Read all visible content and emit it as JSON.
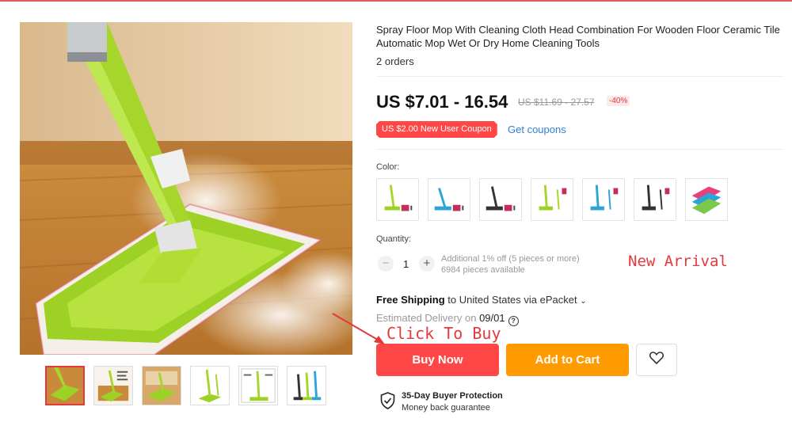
{
  "product": {
    "title": "Spray Floor Mop With Cleaning Cloth Head Combination For Wooden Floor Ceramic Tile Automatic Mop Wet Or Dry Home Cleaning Tools",
    "orders": "2 orders",
    "price": "US $7.01 - 16.54",
    "original_price": "US $11.69 - 27.57",
    "discount": "-40%"
  },
  "coupon": {
    "label": "US $2.00 New User Coupon",
    "link": "Get coupons"
  },
  "color": {
    "label": "Color:",
    "swatches": [
      {
        "name": "green-mop",
        "color": "#a6d62c"
      },
      {
        "name": "blue-mop",
        "color": "#2ea3d6"
      },
      {
        "name": "black-mop",
        "color": "#333333"
      },
      {
        "name": "green-mop-2",
        "color": "#a6d62c"
      },
      {
        "name": "blue-mop-2",
        "color": "#2ea3d6"
      },
      {
        "name": "black-mop-2",
        "color": "#333333"
      },
      {
        "name": "cloth-pads",
        "color": "#4cc3b8"
      }
    ]
  },
  "quantity": {
    "label": "Quantity:",
    "value": "1",
    "minus": "−",
    "plus": "+",
    "note_line1": "Additional 1% off (5 pieces or more)",
    "note_line2": "6984 pieces available"
  },
  "overlay": {
    "new_arrival": "New Arrival",
    "click_to_buy": "Click To Buy"
  },
  "shipping": {
    "free": "Free Shipping",
    "destination": " to United States via ePacket",
    "estimated_label": "Estimated Delivery on ",
    "estimated_date": "09/01",
    "help": "?"
  },
  "actions": {
    "buy_now": "Buy Now",
    "add_to_cart": "Add to Cart"
  },
  "protection": {
    "title": "35-Day Buyer Protection",
    "subtitle": "Money back guarantee"
  },
  "colors": {
    "accent_red": "#ff4747",
    "accent_orange": "#ff9a00",
    "link_blue": "#2f7fd8",
    "mop_green": "#a6d62c"
  },
  "icons": {
    "wishlist": "heart-icon",
    "protection": "shield-check-icon",
    "shipping_dropdown": "chevron-down-icon",
    "help": "question-circle-icon"
  }
}
